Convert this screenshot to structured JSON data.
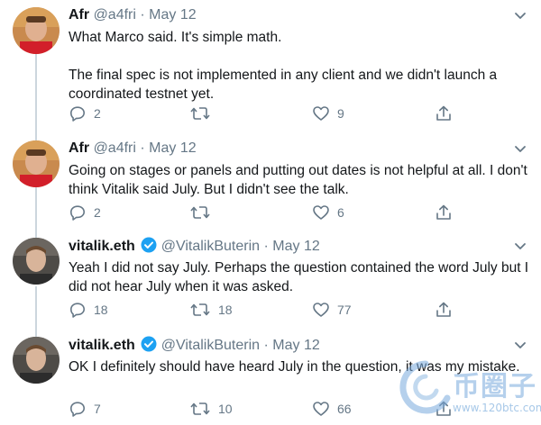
{
  "tweets": [
    {
      "name": "Afr",
      "handle": "@a4fri",
      "separator": "·",
      "date": "May 12",
      "verified": false,
      "text": "What Marco said. It's simple math.\n\nThe final spec is not implemented in any client and we didn't launch a coordinated testnet yet.",
      "replies": "2",
      "retweets": "",
      "likes": "9"
    },
    {
      "name": "Afr",
      "handle": "@a4fri",
      "separator": "·",
      "date": "May 12",
      "verified": false,
      "text": "Going on stages or panels and putting out dates is not helpful at all. I don't think Vitalik said July. But I didn't see the talk.",
      "replies": "2",
      "retweets": "",
      "likes": "6"
    },
    {
      "name": "vitalik.eth",
      "handle": "@VitalikButerin",
      "separator": "·",
      "date": "May 12",
      "verified": true,
      "text": "Yeah I did not say July. Perhaps the question contained the word July but I did not hear July when it was asked.",
      "replies": "18",
      "retweets": "18",
      "likes": "77"
    },
    {
      "name": "vitalik.eth",
      "handle": "@VitalikButerin",
      "separator": "·",
      "date": "May 12",
      "verified": true,
      "text": "OK I definitely should have heard July in the question, it was my mistake.",
      "replies": "7",
      "retweets": "10",
      "likes": "66"
    }
  ],
  "watermark": {
    "logo_text": "币圈子",
    "url": "www.120btc.com"
  },
  "colors": {
    "text": "#14171a",
    "muted": "#657786",
    "verified_blue": "#1da1f2",
    "thread_line": "#ccd6dd"
  }
}
